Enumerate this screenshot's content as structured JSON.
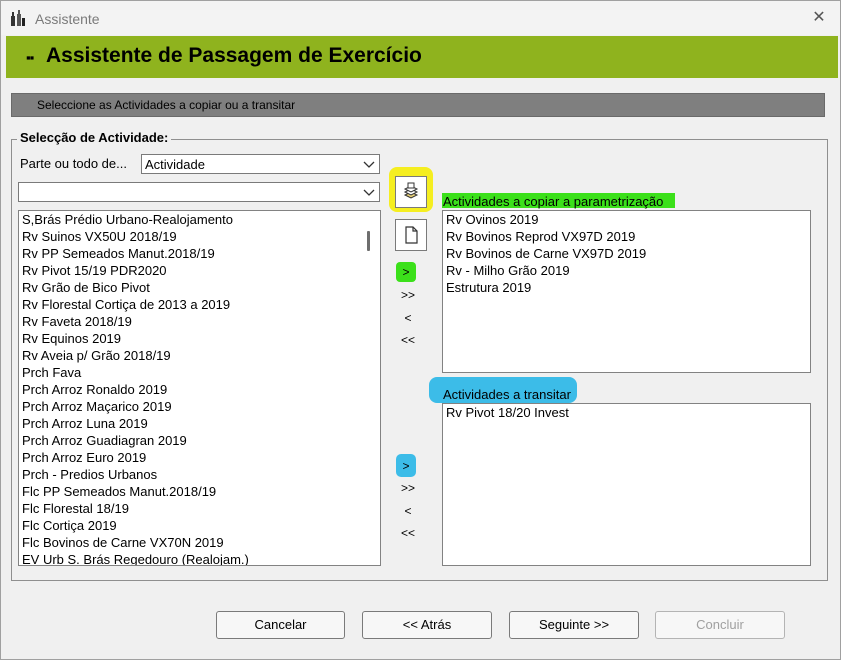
{
  "window": {
    "title": "Assistente",
    "icon": "wine-bottles-icon"
  },
  "banner": {
    "bullet": "▪▪",
    "title": "Assistente de Passagem de Exercício"
  },
  "instruction": "Seleccione as Actividades a copiar ou a transitar",
  "group": {
    "legend": "Selecção de Actividade:",
    "parte_label": "Parte ou todo de...",
    "parte_value": "Actividade",
    "filter_value": ""
  },
  "available_list": [
    "S,Brás Prédio Urbano-Realojamento",
    "Rv Suinos VX50U 2018/19",
    "Rv PP Semeados Manut.2018/19",
    "Rv Pivot 15/19 PDR2020",
    "Rv Grão de Bico Pivot",
    "Rv Florestal Cortiça de 2013 a 2019",
    "Rv Faveta 2018/19",
    "Rv Equinos 2019",
    "Rv Aveia p/ Grão 2018/19",
    "Prch Fava",
    "Prch Arroz Ronaldo 2019",
    "Prch Arroz Maçarico 2019",
    "Prch Arroz Luna 2019",
    "Prch Arroz Guadiagran 2019",
    "Prch Arroz Euro 2019",
    "Prch - Predios Urbanos",
    "Flc PP Semeados Manut.2018/19",
    "Flc Florestal 18/19",
    "Flc Cortiça 2019",
    "Flc Bovinos de Carne VX70N 2019",
    "EV Urb S. Brás Regedouro (Realojam.)"
  ],
  "arrows_top": {
    "add": ">",
    "add_all": ">>",
    "remove": "<",
    "remove_all": "<<"
  },
  "arrows_bottom": {
    "add": ">",
    "add_all": ">>",
    "remove": "<",
    "remove_all": "<<"
  },
  "copy_section": {
    "label": "Actividades a copiar a parametrização",
    "items": [
      "Rv Ovinos 2019",
      "Rv Bovinos Reprod VX97D  2019",
      "Rv Bovinos de Carne VX97D 2019",
      "Rv - Milho Grão 2019",
      "Estrutura 2019"
    ]
  },
  "transit_section": {
    "label": "Actividades a transitar",
    "items": [
      "Rv Pivot 18/20 Invest"
    ]
  },
  "buttons": {
    "cancel": "Cancelar",
    "back": "<< Atrás",
    "next": "Seguinte >>",
    "finish": "Concluir"
  },
  "colors": {
    "banner": "#8fb31e",
    "instruction_bar": "#7f7f7f",
    "highlight_yellow": "#f5ee20",
    "highlight_green": "#3be01a",
    "highlight_blue": "#3cbce8"
  },
  "icons": {
    "copy_params": "stacked-documents-icon",
    "new_doc": "blank-document-icon",
    "dropdown": "chevron-down-icon",
    "close": "close-icon"
  }
}
